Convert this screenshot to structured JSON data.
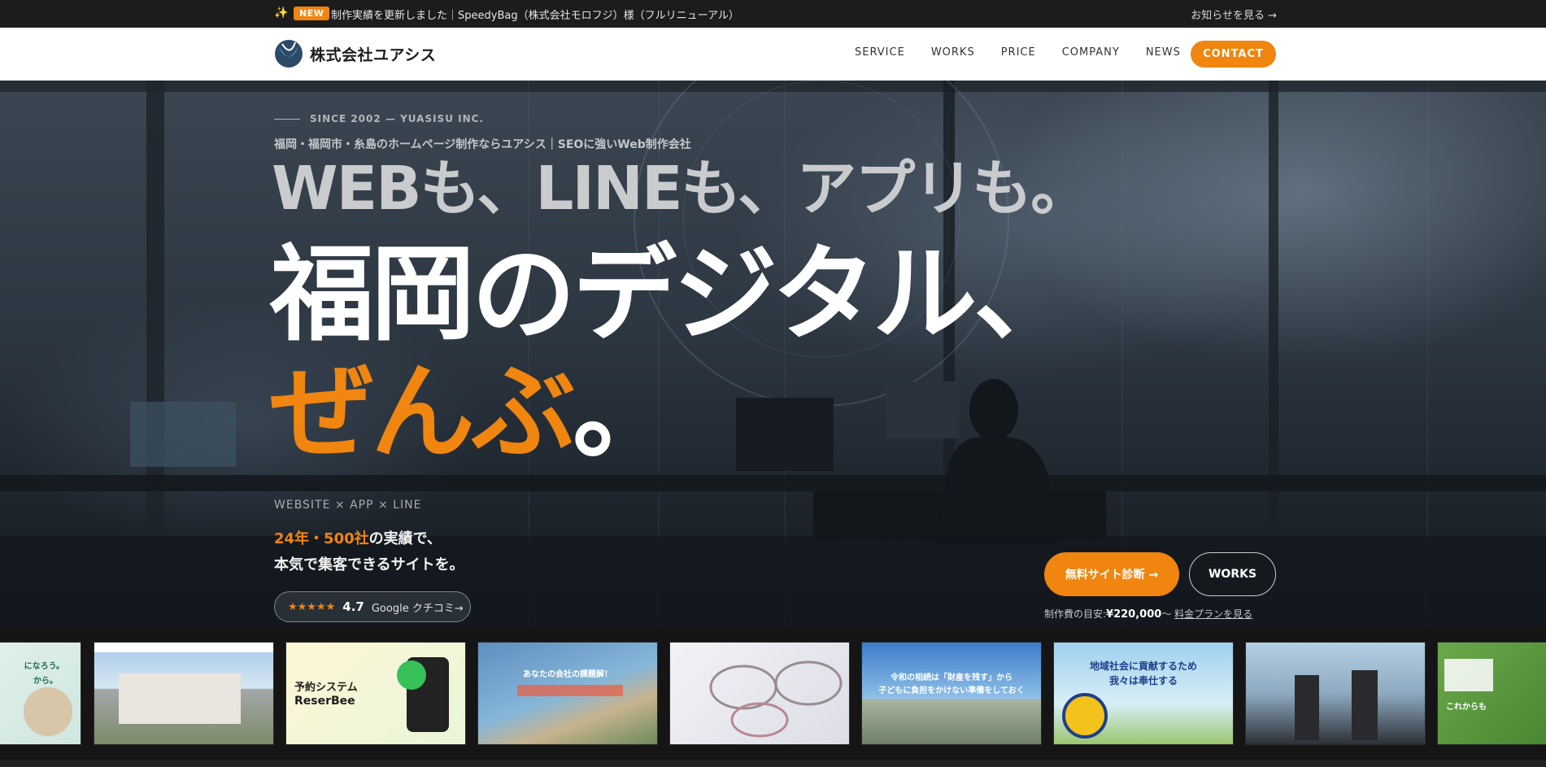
{
  "announcement": {
    "icon": "sparkle-icon",
    "badge": "NEW",
    "message": "制作実績を更新しました｜SpeedyBag（株式会社モロフジ）様（フルリニューアル）",
    "more_link": "お知らせを見る →"
  },
  "header": {
    "logo_text": "株式会社ユアシス",
    "nav": [
      "SERVICE",
      "WORKS",
      "PRICE",
      "COMPANY",
      "NEWS"
    ],
    "contact_label": "CONTACT"
  },
  "hero": {
    "kicker": "SINCE 2002 — YUASISU INC.",
    "subhead": "福岡・福岡市・糸島のホームページ制作ならユアシス｜SEOに強いWeb制作会社",
    "tagline": "WEBも、LINEも、アプリも。",
    "headline_line1": "福岡のデジタル、",
    "headline_accent": "ぜんぶ",
    "headline_end": "。",
    "tech_line": "WEBSITE × APP × LINE",
    "lead_highlight": "24年・500社",
    "lead_rest": "の実績で、",
    "lead_line2": "本気で集客できるサイトを。",
    "review": {
      "stars": "★★★★★",
      "score": "4.7",
      "link": "Google クチコミ→"
    },
    "cta_primary": "無料サイト診断 →",
    "cta_secondary": "WORKS",
    "price_label": "制作費の目安:",
    "price_amount": "¥220,000",
    "price_suffix": "〜",
    "price_link": "料金プランを見る"
  },
  "works_strip": {
    "items": [
      {
        "caption": "になろう。",
        "caption2": "から。"
      },
      {
        "caption": ""
      },
      {
        "caption": "予約システム",
        "caption2": "ReserBee"
      },
      {
        "caption": "あなたの会社の課題解！"
      },
      {
        "caption": ""
      },
      {
        "caption": "令和の相続は「財産を残す」から",
        "caption2": "子どもに負担をかけない準備をしておく"
      },
      {
        "caption": "地域社会に貢献するため",
        "caption2": "我々は奉仕する"
      },
      {
        "caption": ""
      },
      {
        "caption": "これからも"
      }
    ]
  },
  "colors": {
    "accent": "#f0850f",
    "header_bg": "#ffffff",
    "topbar_bg": "#1c1c1c"
  }
}
